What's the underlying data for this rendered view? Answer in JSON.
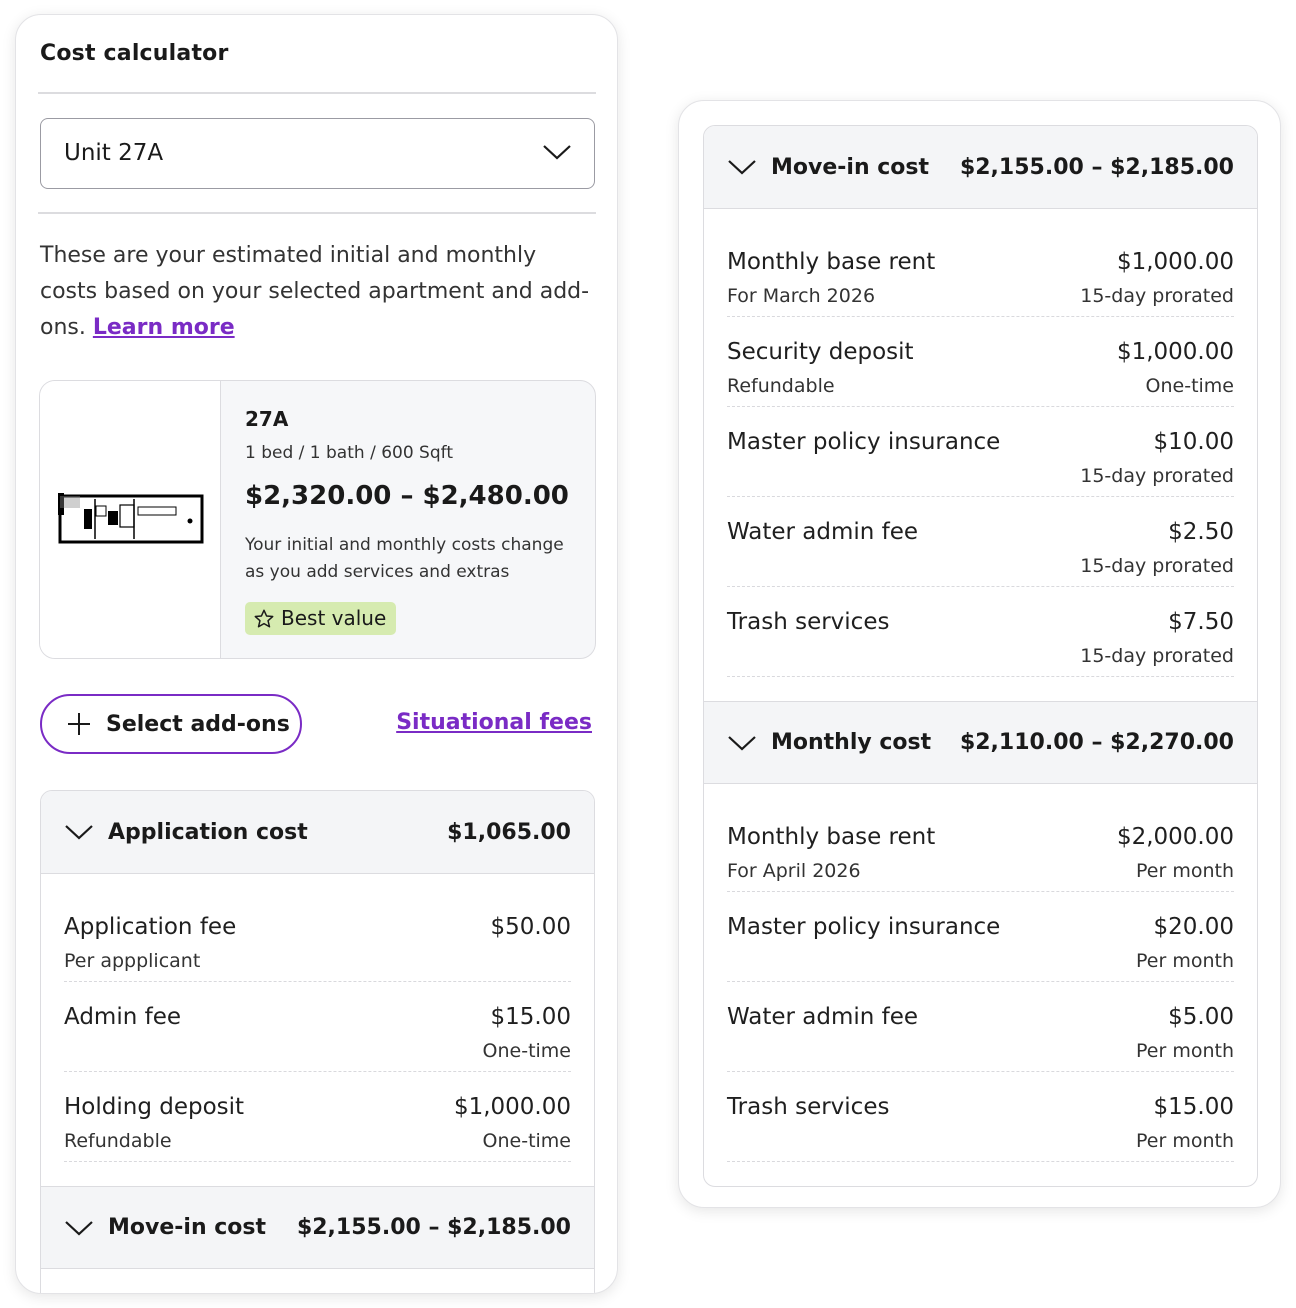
{
  "calculator": {
    "title": "Cost calculator",
    "unit_select_value": "Unit 27A",
    "description": "These are your estimated initial and monthly costs based on your selected apartment and add-ons.",
    "learn_more": "Learn more",
    "select_addons": "Select add-ons",
    "situational_fees": "Situational fees"
  },
  "unit": {
    "name": "27A",
    "meta": "1 bed / 1 bath / 600 Sqft",
    "price_range": "$2,320.00 – $2,480.00",
    "note": "Your initial and monthly costs change as you add services and extras",
    "badge": "Best value"
  },
  "application_cost": {
    "label": "Application cost",
    "amount": "$1,065.00",
    "items": [
      {
        "label": "Application fee",
        "sub": "Per appplicant",
        "value": "$50.00",
        "note": ""
      },
      {
        "label": "Admin fee",
        "sub": "",
        "value": "$15.00",
        "note": "One-time"
      },
      {
        "label": "Holding deposit",
        "sub": "Refundable",
        "value": "$1,000.00",
        "note": "One-time"
      }
    ]
  },
  "move_in_cost": {
    "label": "Move-in cost",
    "amount": "$2,155.00 – $2,185.00",
    "items": [
      {
        "label": "Monthly base rent",
        "sub": "For March 2026",
        "value": "$1,000.00",
        "note": "15-day prorated"
      },
      {
        "label": "Security deposit",
        "sub": "Refundable",
        "value": "$1,000.00",
        "note": "One-time"
      },
      {
        "label": "Master policy insurance",
        "sub": "",
        "value": "$10.00",
        "note": "15-day prorated"
      },
      {
        "label": "Water admin fee",
        "sub": "",
        "value": "$2.50",
        "note": "15-day prorated"
      },
      {
        "label": "Trash services",
        "sub": "",
        "value": "$7.50",
        "note": "15-day prorated"
      }
    ]
  },
  "monthly_cost": {
    "label": "Monthly cost",
    "amount": "$2,110.00 – $2,270.00",
    "items": [
      {
        "label": "Monthly base rent",
        "sub": "For April 2026",
        "value": "$2,000.00",
        "note": "Per month"
      },
      {
        "label": "Master policy insurance",
        "sub": "",
        "value": "$20.00",
        "note": "Per month"
      },
      {
        "label": "Water admin fee",
        "sub": "",
        "value": "$5.00",
        "note": "Per month"
      },
      {
        "label": "Trash services",
        "sub": "",
        "value": "$15.00",
        "note": "Per month"
      }
    ]
  },
  "colors": {
    "accent": "#7a2bc5",
    "badge_bg": "#d6ebb0",
    "header_bg": "#f4f5f7"
  }
}
